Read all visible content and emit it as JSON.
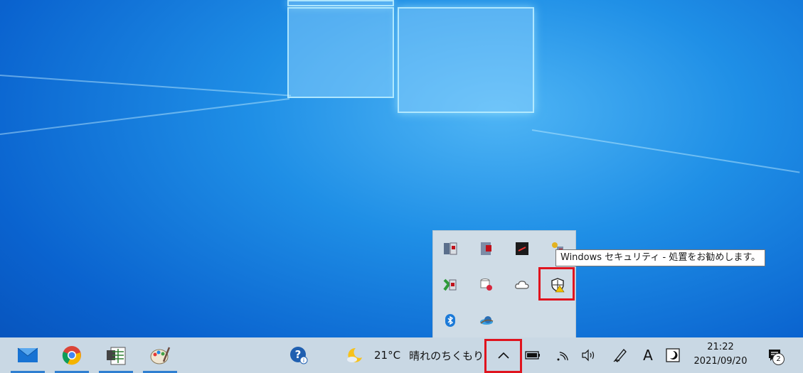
{
  "desktop": {
    "tray_overflow": {
      "icons": [
        {
          "name": "server-monitor-icon"
        },
        {
          "name": "book-shield-icon"
        },
        {
          "name": "black-device-icon"
        },
        {
          "name": "key-tool-icon"
        },
        {
          "name": "network-tool-icon"
        },
        {
          "name": "database-gear-icon"
        },
        {
          "name": "cloud-icon"
        },
        {
          "name": "windows-security-warning-icon"
        },
        {
          "name": "bluetooth-icon"
        },
        {
          "name": "planet-app-icon"
        }
      ],
      "tooltip": "Windows セキュリティ - 処置をお勧めします。"
    }
  },
  "taskbar": {
    "pinned_apps": [
      {
        "name": "mail-app-icon",
        "running": true
      },
      {
        "name": "chrome-app-icon",
        "running": true
      },
      {
        "name": "spreadsheet-app-icon",
        "running": true
      },
      {
        "name": "paint-app-icon",
        "running": true
      }
    ],
    "weather": {
      "temperature": "21°C",
      "condition": "晴れのちくもり"
    },
    "clock": {
      "time": "21:22",
      "date": "2021/09/20"
    },
    "ime_indicator": "A",
    "notifications": {
      "count": "2"
    },
    "colors": {
      "taskbar_bg": "#c9d8e4",
      "highlight": "#e0141e",
      "running_indicator": "#2f7fd1"
    }
  }
}
